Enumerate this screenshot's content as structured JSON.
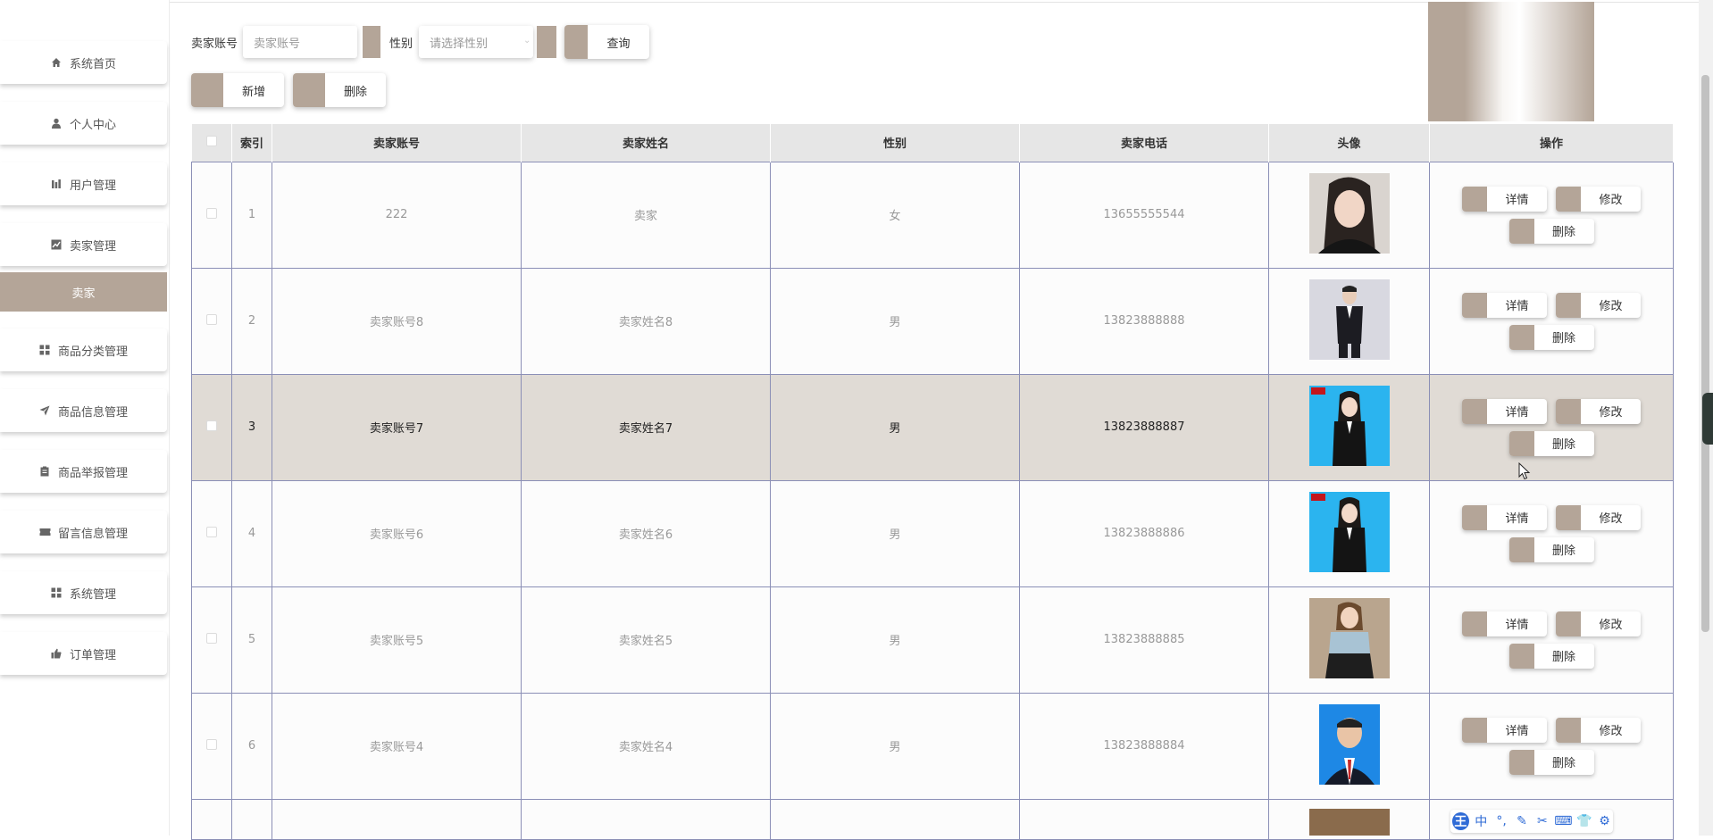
{
  "sidebar": {
    "items": [
      {
        "label": "系统首页",
        "icon": "home-icon"
      },
      {
        "label": "个人中心",
        "icon": "user-icon"
      },
      {
        "label": "用户管理",
        "icon": "bar-chart-icon"
      },
      {
        "label": "卖家管理",
        "icon": "line-chart-icon"
      },
      {
        "label": "商品分类管理",
        "icon": "grid-icon"
      },
      {
        "label": "商品信息管理",
        "icon": "send-icon"
      },
      {
        "label": "商品举报管理",
        "icon": "clipboard-icon"
      },
      {
        "label": "留言信息管理",
        "icon": "ticket-icon"
      },
      {
        "label": "系统管理",
        "icon": "grid-icon"
      },
      {
        "label": "订单管理",
        "icon": "thumbs-up-icon"
      }
    ],
    "active_sub": "卖家"
  },
  "search": {
    "account_label": "卖家账号",
    "account_placeholder": "卖家账号",
    "gender_label": "性别",
    "gender_placeholder": "请选择性别",
    "query_button": "查询"
  },
  "actions": {
    "add": "新增",
    "delete": "删除"
  },
  "table": {
    "headers": [
      "索引",
      "卖家账号",
      "卖家姓名",
      "性别",
      "卖家电话",
      "头像",
      "操作"
    ],
    "ops": {
      "detail": "详情",
      "edit": "修改",
      "delete": "删除"
    },
    "rows": [
      {
        "index": "1",
        "account": "222",
        "name": "卖家",
        "gender": "女",
        "phone": "13655555544"
      },
      {
        "index": "2",
        "account": "卖家账号8",
        "name": "卖家姓名8",
        "gender": "男",
        "phone": "13823888888"
      },
      {
        "index": "3",
        "account": "卖家账号7",
        "name": "卖家姓名7",
        "gender": "男",
        "phone": "13823888887"
      },
      {
        "index": "4",
        "account": "卖家账号6",
        "name": "卖家姓名6",
        "gender": "男",
        "phone": "13823888886"
      },
      {
        "index": "5",
        "account": "卖家账号5",
        "name": "卖家姓名5",
        "gender": "男",
        "phone": "13823888885"
      },
      {
        "index": "6",
        "account": "卖家账号4",
        "name": "卖家姓名4",
        "gender": "男",
        "phone": "13823888884"
      }
    ]
  },
  "ime": {
    "keys": [
      "王",
      "中",
      "°,",
      "✎",
      "✂",
      "⌨",
      "👕",
      "⚙"
    ]
  },
  "colors": {
    "accent": "#b4a598",
    "header_bg": "#e6e6e6",
    "highlight_row": "#e0dbd5",
    "ime_blue": "#2f6bd6"
  }
}
